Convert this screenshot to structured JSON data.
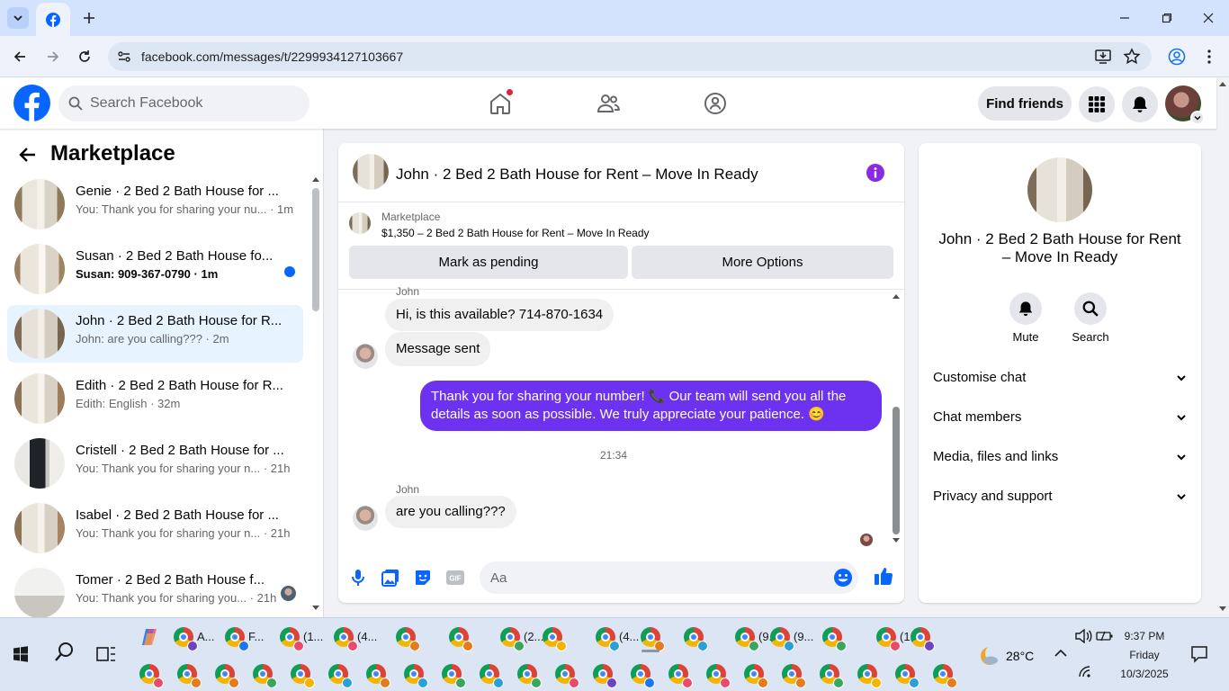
{
  "browser": {
    "url": "facebook.com/messages/t/2299934127103667"
  },
  "fb": {
    "search_placeholder": "Search Facebook",
    "find_friends": "Find friends"
  },
  "left": {
    "title": "Marketplace",
    "conversations": [
      {
        "name": "Genie · 2 Bed 2 Bath House for ...",
        "snippet": "You: Thank you for sharing your nu...",
        "time": "1m",
        "sub": "You: Thank you for sharing your nu... · 1m"
      },
      {
        "name": "Susan · 2 Bed 2 Bath House fo...",
        "sub": "Susan: 909-367-0790 · 1m",
        "unread": true
      },
      {
        "name": "John · 2 Bed 2 Bath House for R...",
        "sub": "John: are you calling??? · 2m",
        "active": true
      },
      {
        "name": "Edith · 2 Bed 2 Bath House for R...",
        "sub": "Edith: English · 32m"
      },
      {
        "name": "Cristell · 2 Bed 2 Bath House for ...",
        "sub": "You: Thank you for sharing your n... · 21h"
      },
      {
        "name": "Isabel · 2 Bed 2 Bath House for ...",
        "sub": "You: Thank you for sharing your n... · 21h"
      },
      {
        "name": "Tomer · 2 Bed 2 Bath House f...",
        "sub": "You: Thank you for sharing you... · 21h"
      }
    ]
  },
  "chat": {
    "title": "John · 2 Bed 2 Bath House for Rent – Move In Ready",
    "listing_source": "Marketplace",
    "listing_title": "$1,350 – 2 Bed 2 Bath House for Rent – Move In Ready",
    "mark_pending": "Mark as pending",
    "more_options": "More Options",
    "sender1": "John",
    "msg1": "Hi, is this available?  714-870-1634",
    "msg2": "Message sent",
    "msg3": "Thank you for sharing your number! 📞 Our team will send you all the details as soon as possible. We truly appreciate your patience. 😊",
    "timestamp": "21:34",
    "sender2": "John",
    "msg4": "are you calling???",
    "composer_placeholder": "Aa"
  },
  "right": {
    "title": "John · 2 Bed 2 Bath House for Rent – Move In Ready",
    "mute": "Mute",
    "search": "Search",
    "rows": [
      "Customise chat",
      "Chat members",
      "Media, files and links",
      "Privacy and support"
    ]
  },
  "taskbar": {
    "labels": [
      "A...",
      "F...",
      "(1...",
      "(4...",
      "(2...",
      "(4...",
      "(9...",
      "(9...",
      "(1..."
    ],
    "weather": "28°C",
    "time": "9:37 PM",
    "day": "Friday",
    "date": "10/3/2025"
  },
  "colors": {
    "brand": "#0866ff",
    "outgoing_bubble": "#6d31f0",
    "notification_red": "#e41e3f"
  }
}
